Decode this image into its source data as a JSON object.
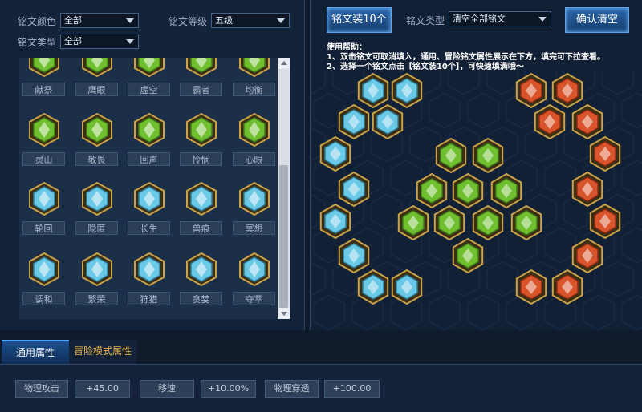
{
  "filters": {
    "color_label": "铭文颜色",
    "color_value": "全部",
    "level_label": "铭文等级",
    "level_value": "五级",
    "type_label": "铭文类型",
    "type_value": "全部"
  },
  "inscriptions": [
    {
      "name": "献祭",
      "color": "green"
    },
    {
      "name": "鹰眼",
      "color": "green"
    },
    {
      "name": "虚空",
      "color": "green"
    },
    {
      "name": "霸者",
      "color": "green"
    },
    {
      "name": "均衡",
      "color": "green"
    },
    {
      "name": "灵山",
      "color": "green"
    },
    {
      "name": "敬畏",
      "color": "green"
    },
    {
      "name": "回声",
      "color": "green"
    },
    {
      "name": "怜悯",
      "color": "green"
    },
    {
      "name": "心眼",
      "color": "green"
    },
    {
      "name": "轮回",
      "color": "blue"
    },
    {
      "name": "隐匿",
      "color": "blue"
    },
    {
      "name": "长生",
      "color": "blue"
    },
    {
      "name": "兽痕",
      "color": "blue"
    },
    {
      "name": "冥想",
      "color": "blue"
    },
    {
      "name": "调和",
      "color": "blue"
    },
    {
      "name": "繁荣",
      "color": "blue"
    },
    {
      "name": "狩猎",
      "color": "blue"
    },
    {
      "name": "贪婪",
      "color": "blue"
    },
    {
      "name": "夺萃",
      "color": "blue"
    }
  ],
  "toolbar": {
    "equip_button": "铭文装10个",
    "type_label": "铭文类型",
    "type_value": "清空全部铭文",
    "clear_button": "确认清空"
  },
  "help": {
    "line1": "使用帮助：",
    "line2": "1、双击铭文可取消填入，通用、冒险铭文属性展示在下方，填完可下拉查看。",
    "line3": "2、选择一个铭文点击【铭文装10个】，可快速填满哦～"
  },
  "tabs": {
    "common": "通用属性",
    "adventure": "冒险模式属性"
  },
  "attributes": [
    {
      "name": "物理攻击",
      "value": "+45.00"
    },
    {
      "name": "移速",
      "value": "+10.00%"
    },
    {
      "name": "物理穿透",
      "value": "+100.00"
    }
  ],
  "colors": {
    "green": "#6fbf2e",
    "blue": "#69c9e6",
    "red": "#d9542b",
    "gold": "#c9a24a"
  },
  "icons": {
    "dropdown": "chevron-down-icon",
    "inscription_gem": "hexagon-gem-icon",
    "board_slot": "hexagon-slot-icon"
  }
}
